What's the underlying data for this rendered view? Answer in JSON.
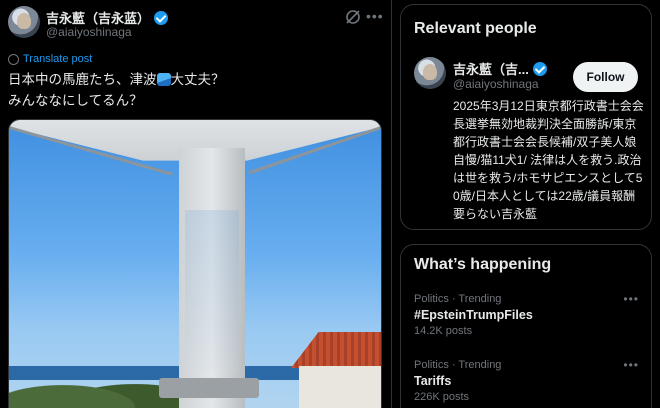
{
  "tweet": {
    "author_name": "吉永藍（吉永蓝）",
    "author_handle": "@aiaiyoshinaga",
    "translate_label": "Translate post",
    "text_line1_a": "日本中の馬鹿たち、津波",
    "text_line1_b": "大丈夫？",
    "text_line2": "みんななにしてるん？"
  },
  "relevant_people": {
    "title": "Relevant people",
    "person": {
      "name": "吉永藍（吉...",
      "handle": "@aiaiyoshinaga",
      "follow_label": "Follow",
      "bio": "2025年3月12日東京都行政書士会会長選挙無効地裁判決全面勝訴/東京都行政書士会会長候補/双子美人娘自慢/猫11犬1/ 法律は人を救う.政治は世を救う/ホモサピエンスとして50歳/日本人としては22歳/議員報酬要らない吉永藍"
    }
  },
  "whats_happening": {
    "title": "What’s happening",
    "trends": [
      {
        "meta": "Politics · Trending",
        "name": "#EpsteinTrumpFiles",
        "count": "14.2K posts"
      },
      {
        "meta": "Politics · Trending",
        "name": "Tariffs",
        "count": "226K posts"
      }
    ]
  },
  "colors": {
    "accent": "#1d9bf0",
    "background": "#000000",
    "muted": "#71767b"
  },
  "icons": [
    "verified-badge-icon",
    "grok-icon",
    "more-icon",
    "globe-icon",
    "wave-emoji-icon"
  ]
}
